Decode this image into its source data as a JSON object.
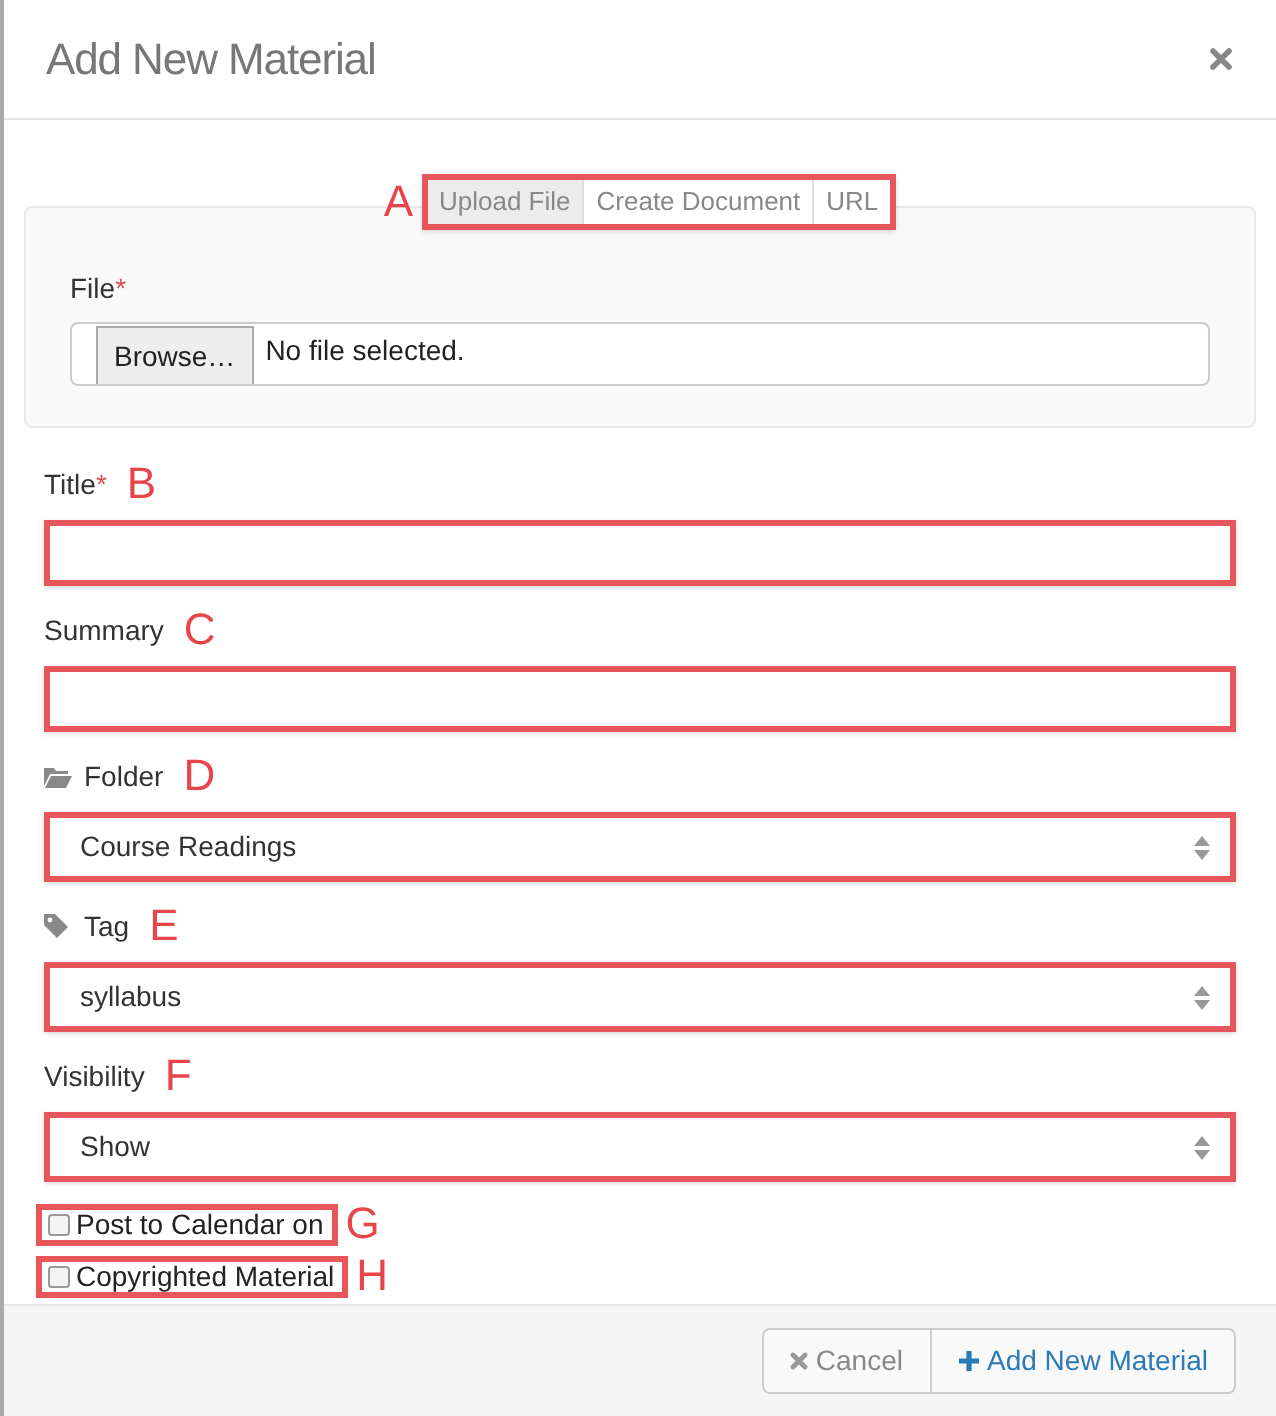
{
  "dialog": {
    "title": "Add New Material"
  },
  "source_tabs": {
    "annotation": "A",
    "tabs": [
      {
        "label": "Upload File",
        "selected": true
      },
      {
        "label": "Create Document",
        "selected": false
      },
      {
        "label": "URL",
        "selected": false
      }
    ]
  },
  "file_field": {
    "label": "File",
    "required_mark": "*",
    "button": "Browse…",
    "value": "No file selected."
  },
  "fields": [
    {
      "kind": "text",
      "label": "Title",
      "required_mark": "*",
      "annotation": "B"
    },
    {
      "kind": "text",
      "label": "Summary",
      "annotation": "C"
    },
    {
      "kind": "folder",
      "label": "Folder",
      "value": "Course Readings",
      "annotation": "D"
    },
    {
      "kind": "tag",
      "label": "Tag",
      "value": "syllabus",
      "annotation": "E"
    },
    {
      "kind": "select",
      "label": "Visibility",
      "value": "Show",
      "annotation": "F"
    }
  ],
  "checkboxes": [
    {
      "label": "Post to Calendar on",
      "checked": false,
      "annotation": "G"
    },
    {
      "label": "Copyrighted Material",
      "checked": false,
      "annotation": "H"
    }
  ],
  "footer": {
    "cancel": "Cancel",
    "submit": "Add New Material"
  }
}
